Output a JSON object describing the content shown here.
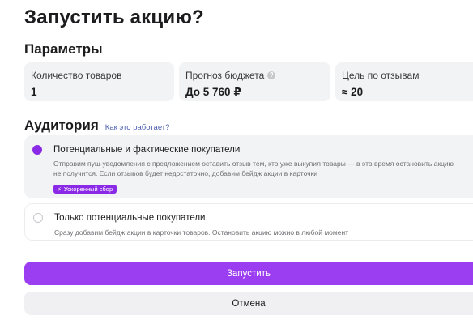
{
  "title": "Запустить акцию?",
  "parameters": {
    "heading": "Параметры",
    "cards": [
      {
        "label": "Количество товаров",
        "value": "1"
      },
      {
        "label": "Прогноз бюджета",
        "value": "До 5 760 ₽",
        "info_icon": "?"
      },
      {
        "label": "Цель по отзывам",
        "value": "≈ 20"
      }
    ]
  },
  "audience": {
    "heading": "Аудитория",
    "how_link": "Как это работает?",
    "options": [
      {
        "title": "Потенциальные и фактические покупатели",
        "description": "Отправим пуш-уведомления с предложением оставить отзыв тем, кто уже выкупил товары — в это время остановить акцию не получится. Если отзывов будет недостаточно, добавим бейдж акции в карточки",
        "badge": "Ускоренный сбор",
        "badge_icon": "⚡",
        "selected": true
      },
      {
        "title": "Только потенциальные покупатели",
        "description": "Сразу добавим бейдж акции в карточки товаров. Остановить акцию можно в любой момент",
        "selected": false
      }
    ]
  },
  "actions": {
    "launch": "Запустить",
    "cancel": "Отмена"
  },
  "colors": {
    "accent": "#9b3df0",
    "radio_selected": "#8b2ae6",
    "link": "#4d5fb2",
    "card_bg": "#f2f3f5"
  }
}
